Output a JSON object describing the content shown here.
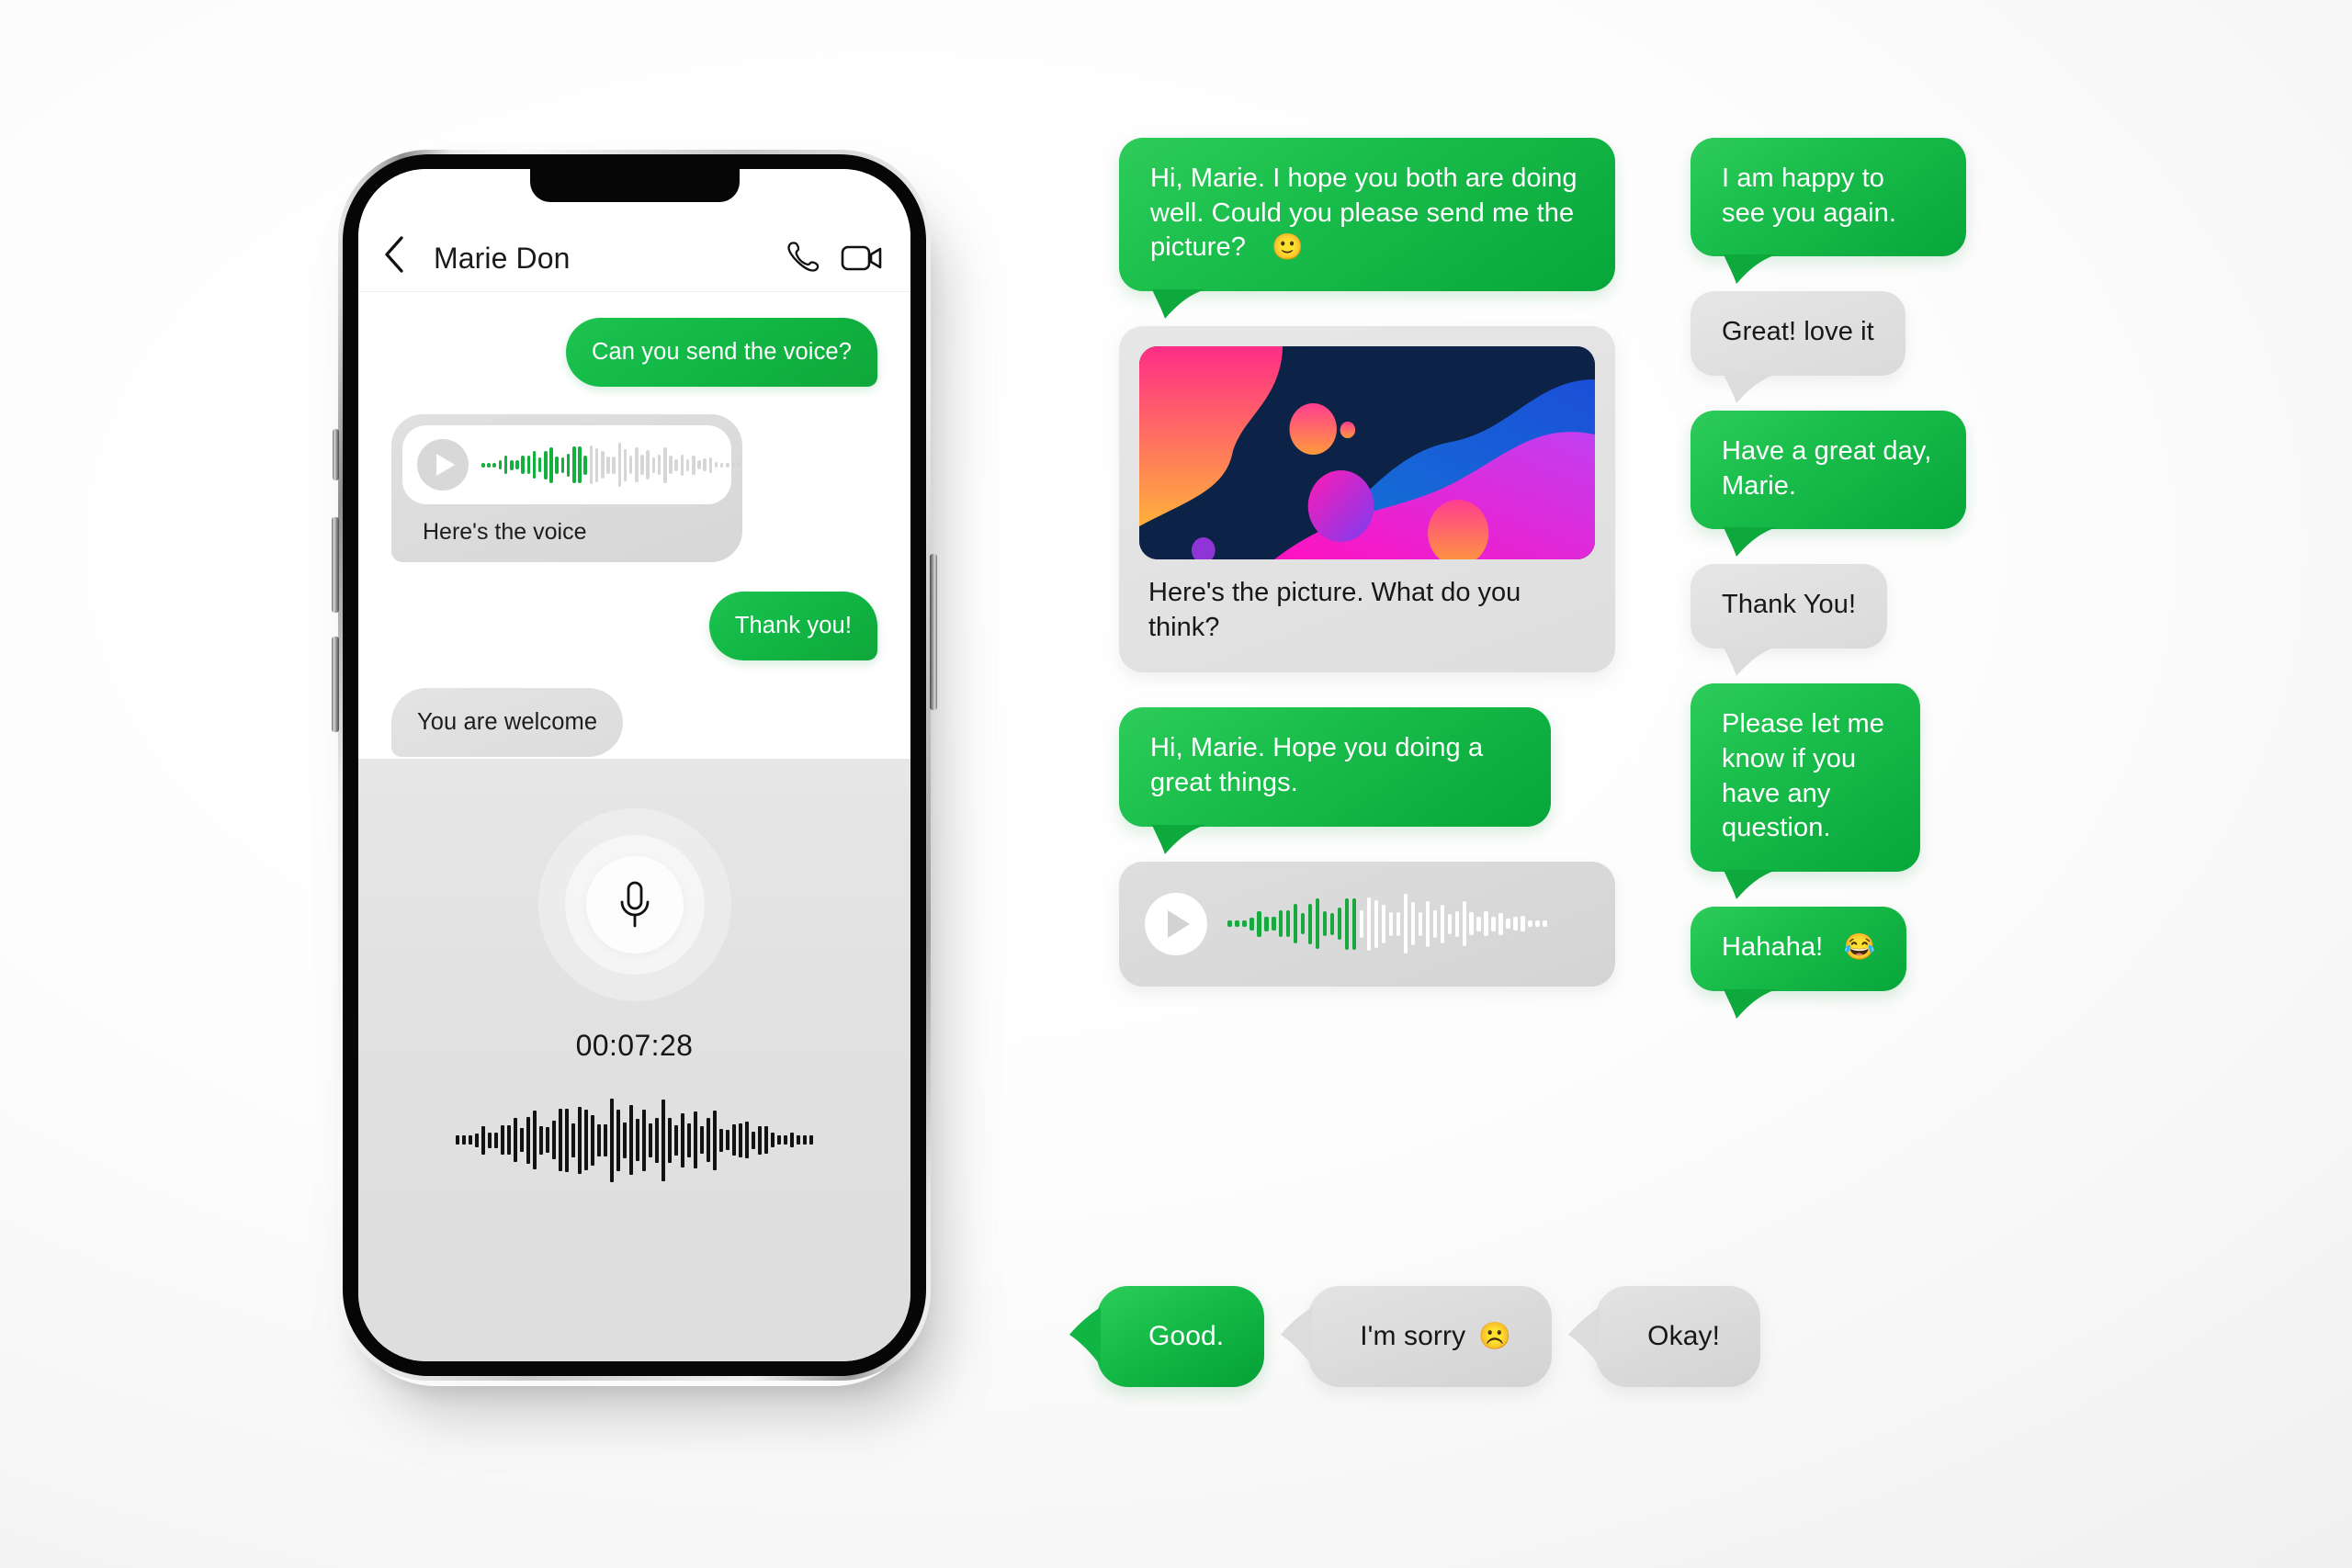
{
  "phone": {
    "header": {
      "back_icon": "chevron-left-icon",
      "contact_name": "Marie Don",
      "call_icon": "phone-icon",
      "video_icon": "video-camera-icon"
    },
    "messages": [
      {
        "side": "right",
        "type": "text",
        "text": "Can you send the voice?"
      },
      {
        "side": "left",
        "type": "voice",
        "caption": "Here's the voice",
        "play_icon": "play-icon"
      },
      {
        "side": "right",
        "type": "text",
        "text": "Thank you!"
      },
      {
        "side": "left",
        "type": "text",
        "text": "You are welcome"
      }
    ],
    "recorder": {
      "mic_icon": "microphone-icon",
      "timer": "00:07:28"
    }
  },
  "kit": {
    "middle_column": [
      {
        "type": "text",
        "style": "green",
        "text": "Hi, Marie. I hope you both are doing well. Could you please send me the picture?",
        "emoji": "🙂"
      },
      {
        "type": "image",
        "style": "gray",
        "caption": "Here's the picture. What do you think?",
        "alt": "abstract-gradient-artwork"
      },
      {
        "type": "text",
        "style": "green",
        "text": "Hi, Marie. Hope you doing a great things."
      },
      {
        "type": "voice",
        "style": "gray",
        "play_icon": "play-icon"
      }
    ],
    "right_column": [
      {
        "type": "text",
        "style": "green",
        "text": "I am happy to see you again."
      },
      {
        "type": "text",
        "style": "gray",
        "text": "Great! love it"
      },
      {
        "type": "text",
        "style": "green",
        "text": "Have a great day, Marie."
      },
      {
        "type": "text",
        "style": "gray",
        "text": "Thank You!"
      },
      {
        "type": "text",
        "style": "green",
        "text": "Please let me know if you have any question."
      },
      {
        "type": "text",
        "style": "green",
        "text": "Hahaha!",
        "emoji": "😂"
      }
    ],
    "chips": [
      {
        "style": "green",
        "text": "Good."
      },
      {
        "style": "gray",
        "text": "I'm sorry",
        "emoji": "☹️"
      },
      {
        "style": "gray",
        "text": "Okay!"
      }
    ]
  },
  "colors": {
    "brand_green": "#0fa73b",
    "green_light": "#2ecc5a",
    "bubble_gray": "#dcdcdc",
    "text_dark": "#171717",
    "page_bg": "#f1f1f1"
  }
}
